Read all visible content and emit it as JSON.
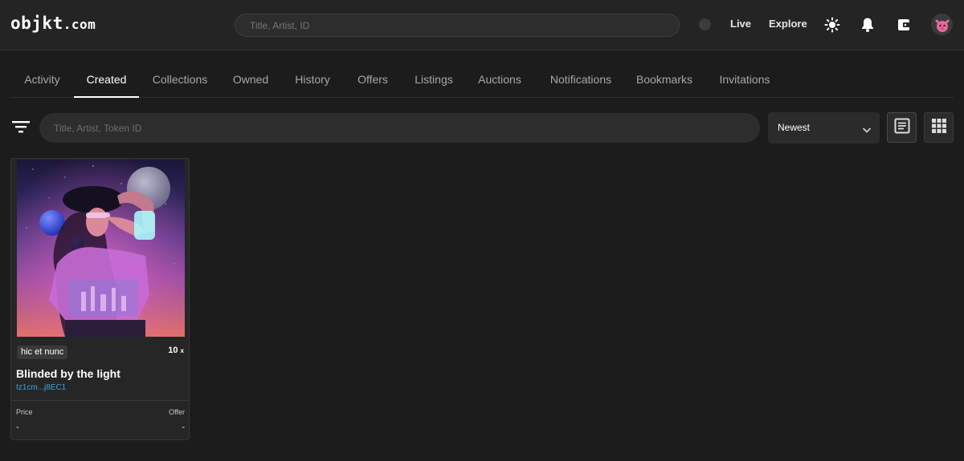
{
  "header": {
    "logo_main": "objkt",
    "logo_suffix": ".com",
    "search_placeholder": "Title, Artist, ID",
    "nav": {
      "live": "Live",
      "explore": "Explore"
    },
    "icons": [
      "theme-sun-icon",
      "bell-icon",
      "wallet-icon",
      "avatar"
    ]
  },
  "tabs": [
    {
      "label": "Activity",
      "active": false
    },
    {
      "label": "Created",
      "active": true
    },
    {
      "label": "Collections",
      "active": false
    },
    {
      "label": "Owned",
      "active": false
    },
    {
      "label": "History",
      "active": false
    },
    {
      "label": "Offers",
      "active": false
    },
    {
      "label": "Listings",
      "active": false
    },
    {
      "label": "Auctions",
      "active": false
    },
    {
      "label": "Notifications",
      "active": false
    },
    {
      "label": "Bookmarks",
      "active": false
    },
    {
      "label": "Invitations",
      "active": false
    }
  ],
  "filters": {
    "search_placeholder": "Title, Artist, Token ID",
    "sort": {
      "selected": "Newest"
    },
    "views": [
      "list-view-icon",
      "grid-view-icon"
    ]
  },
  "cards": [
    {
      "platform_tag": "hic et nunc",
      "editions": "10",
      "editions_suffix": "x",
      "title": "Blinded by the light",
      "creator": "tz1cm...j8EC1",
      "price_label": "Price",
      "offer_label": "Offer",
      "price": "-",
      "offer": "-"
    }
  ],
  "colors": {
    "background": "#1c1c1c",
    "header": "#242424",
    "accent_link": "#3da1e0"
  }
}
